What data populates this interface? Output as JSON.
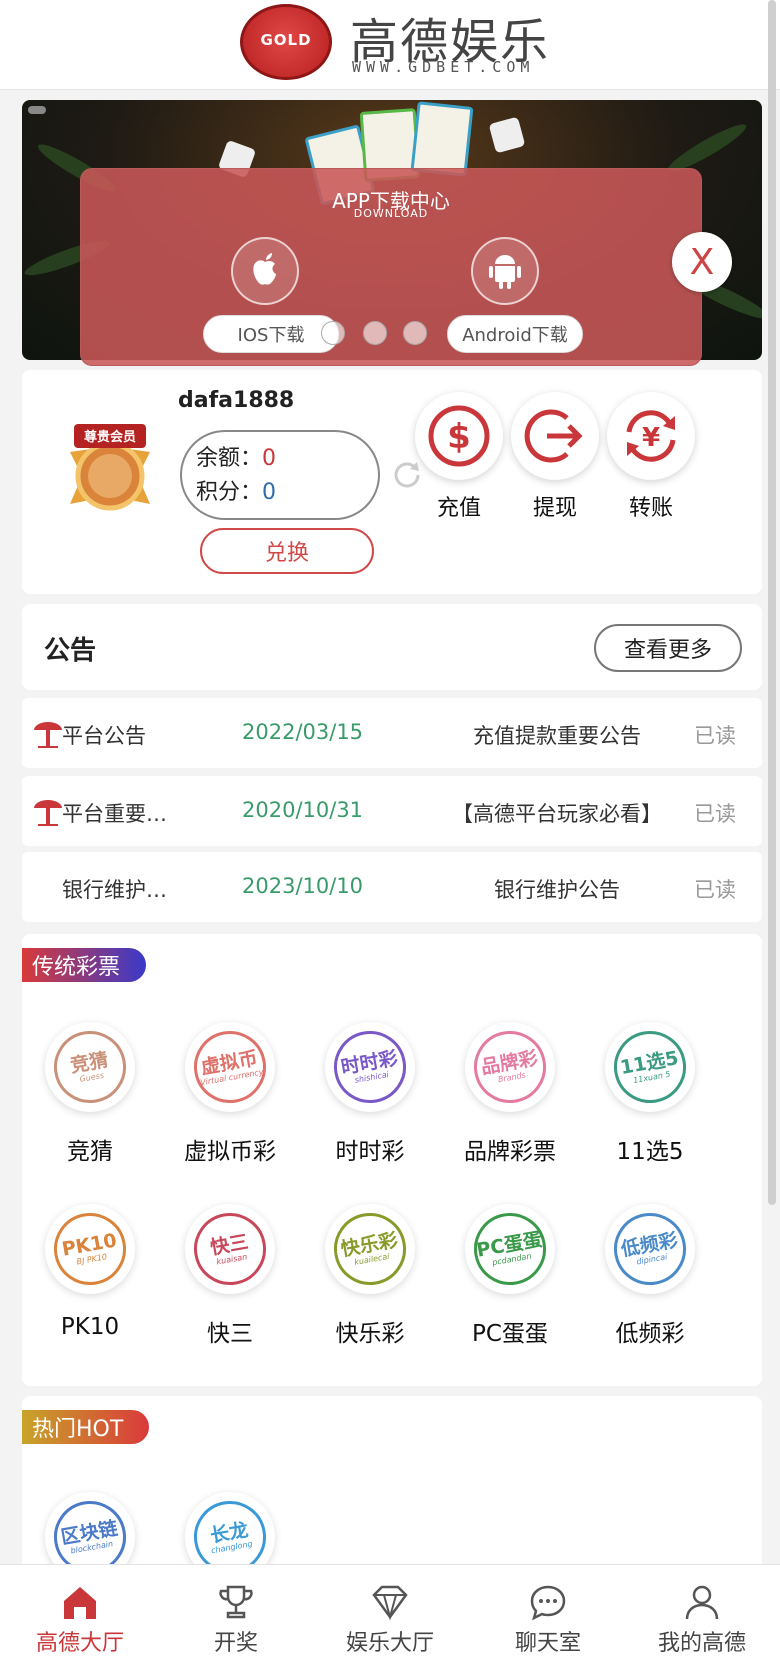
{
  "header": {
    "logo_badge_text": "GOLD",
    "title": "高德娱乐",
    "subtitle": "WWW.GDBET.COM"
  },
  "download_panel": {
    "title": "APP下载中心",
    "subtitle": "DOWNLOAD",
    "ios_label": "IOS下载",
    "android_label": "Android下载",
    "close_label": "X"
  },
  "user": {
    "medal_label": "尊贵会员",
    "username": "dafa1888",
    "balance_label": "余额：",
    "balance_value": "0",
    "points_label": "积分：",
    "points_value": "0",
    "exchange_label": "兑换",
    "actions": [
      {
        "label": "充值",
        "icon": "dollar-icon"
      },
      {
        "label": "提现",
        "icon": "withdraw-icon"
      },
      {
        "label": "转账",
        "icon": "yen-transfer-icon"
      }
    ]
  },
  "notice": {
    "title": "公告",
    "more_label": "查看更多",
    "rows": [
      {
        "type": "平台公告",
        "date": "2022/03/15",
        "subject": "充值提款重要公告",
        "status": "已读"
      },
      {
        "type": "平台重要…",
        "date": "2020/10/31",
        "subject": "【高德平台玩家必看】",
        "status": "已读"
      },
      {
        "type": "银行维护…",
        "date": "2023/10/10",
        "subject": "银行维护公告",
        "status": "已读"
      }
    ]
  },
  "traditional": {
    "tag": "传统彩票",
    "games": [
      {
        "label": "竞猜",
        "icon_main": "竞猜",
        "icon_sub": "Guess",
        "color": "#c9917a"
      },
      {
        "label": "虚拟币彩",
        "icon_main": "虚拟币",
        "icon_sub": "Virtual currency",
        "color": "#e0706a"
      },
      {
        "label": "时时彩",
        "icon_main": "时时彩",
        "icon_sub": "shishicai",
        "color": "#7a58c8"
      },
      {
        "label": "品牌彩票",
        "icon_main": "品牌彩",
        "icon_sub": "Brands",
        "color": "#e47aa0"
      },
      {
        "label": "11选5",
        "icon_main": "11选5",
        "icon_sub": "11xuan 5",
        "color": "#3a9a82"
      },
      {
        "label": "PK10",
        "icon_main": "PK10",
        "icon_sub": "BJ PK10",
        "color": "#d9843a"
      },
      {
        "label": "快三",
        "icon_main": "快三",
        "icon_sub": "kuaisan",
        "color": "#c9475a"
      },
      {
        "label": "快乐彩",
        "icon_main": "快乐彩",
        "icon_sub": "kuailecai",
        "color": "#8a9a2a"
      },
      {
        "label": "PC蛋蛋",
        "icon_main": "PC蛋蛋",
        "icon_sub": "pcdandan",
        "color": "#3a9a4a"
      },
      {
        "label": "低频彩",
        "icon_main": "低频彩",
        "icon_sub": "dipincai",
        "color": "#4a8ac8"
      }
    ]
  },
  "hot": {
    "tag": "热门HOT",
    "games": [
      {
        "icon_main": "区块链",
        "icon_sub": "blockchain",
        "color": "#4a7ac8"
      },
      {
        "icon_main": "长龙",
        "icon_sub": "changlong",
        "color": "#3a9ad8"
      }
    ]
  },
  "bottom_nav": [
    {
      "label": "高德大厅",
      "icon": "home-icon",
      "active": true
    },
    {
      "label": "开奖",
      "icon": "trophy-icon",
      "active": false
    },
    {
      "label": "娱乐大厅",
      "icon": "diamond-icon",
      "active": false
    },
    {
      "label": "聊天室",
      "icon": "chat-icon",
      "active": false
    },
    {
      "label": "我的高德",
      "icon": "user-icon",
      "active": false
    }
  ],
  "colors": {
    "accent": "#c9373a",
    "date_green": "#3a9b6a",
    "tag_traditional_start": "#d93a3a",
    "tag_traditional_end": "#3a3ac8",
    "tag_hot_start": "#c8a42a",
    "tag_hot_end": "#d93a3a"
  }
}
